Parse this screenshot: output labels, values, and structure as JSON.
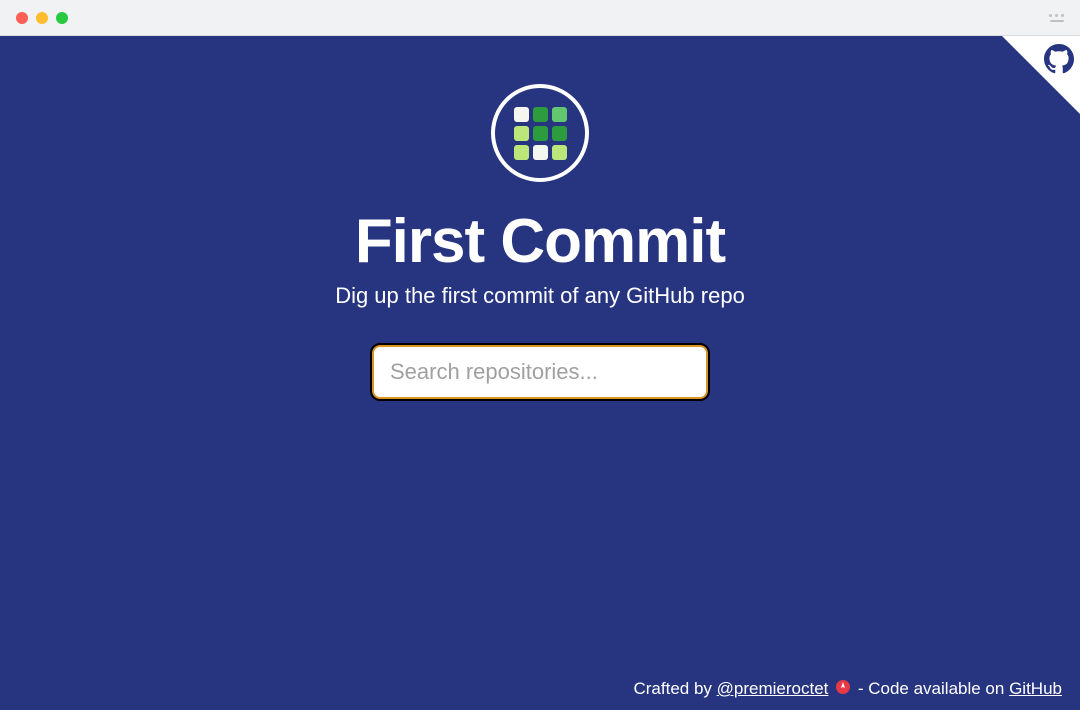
{
  "header": {
    "title": "First Commit",
    "subtitle": "Dig up the first commit of any GitHub repo"
  },
  "search": {
    "placeholder": "Search repositories...",
    "value": ""
  },
  "footer": {
    "crafted_by_prefix": "Crafted by ",
    "author_handle": "@premieroctet",
    "separator": " - Code available on ",
    "code_link_text": "GitHub"
  },
  "logo": {
    "grid": [
      "white",
      "dgreen",
      "mgreen",
      "lgreen",
      "dgreen",
      "dgreen",
      "lgreen",
      "white",
      "lgreen"
    ]
  },
  "colors": {
    "background": "#273480",
    "accent_border": "#d99322"
  }
}
